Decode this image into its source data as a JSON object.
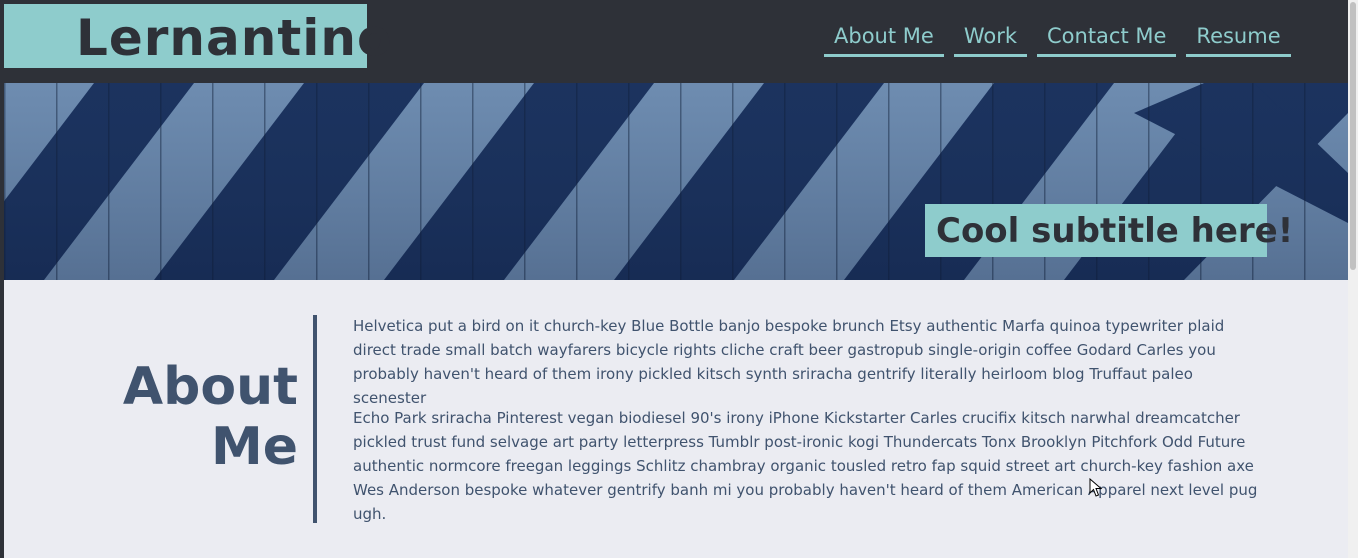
{
  "header": {
    "logo": "Lernantino",
    "nav": [
      {
        "label": "About Me"
      },
      {
        "label": "Work"
      },
      {
        "label": "Contact Me"
      },
      {
        "label": "Resume"
      }
    ]
  },
  "hero": {
    "subtitle": "Cool subtitle here!"
  },
  "about": {
    "title": "About Me",
    "paragraphs": [
      "Helvetica put a bird on it church-key Blue Bottle banjo bespoke brunch Etsy authentic Marfa quinoa typewriter plaid direct trade small batch wayfarers bicycle rights cliche craft beer gastropub single-origin coffee Godard Carles you probably haven't heard of them irony pickled kitsch synth sriracha gentrify literally heirloom blog Truffaut paleo scenester",
      "Echo Park sriracha Pinterest vegan biodiesel 90's irony iPhone Kickstarter Carles crucifix kitsch narwhal dreamcatcher pickled trust fund selvage art party letterpress Tumblr post-ironic kogi Thundercats Tonx Brooklyn Pitchfork Odd Future authentic normcore freegan leggings Schlitz chambray organic tousled retro fap squid street art church-key fashion axe Wes Anderson bespoke whatever gentrify banh mi you probably haven't heard of them American Apparel next level pug ugh."
    ]
  },
  "colors": {
    "header_bg": "#2e3138",
    "accent": "#8ecccc",
    "content_bg": "#ebecf2",
    "text": "#40536e"
  },
  "icons": {
    "cursor": "mouse-pointer-icon"
  }
}
